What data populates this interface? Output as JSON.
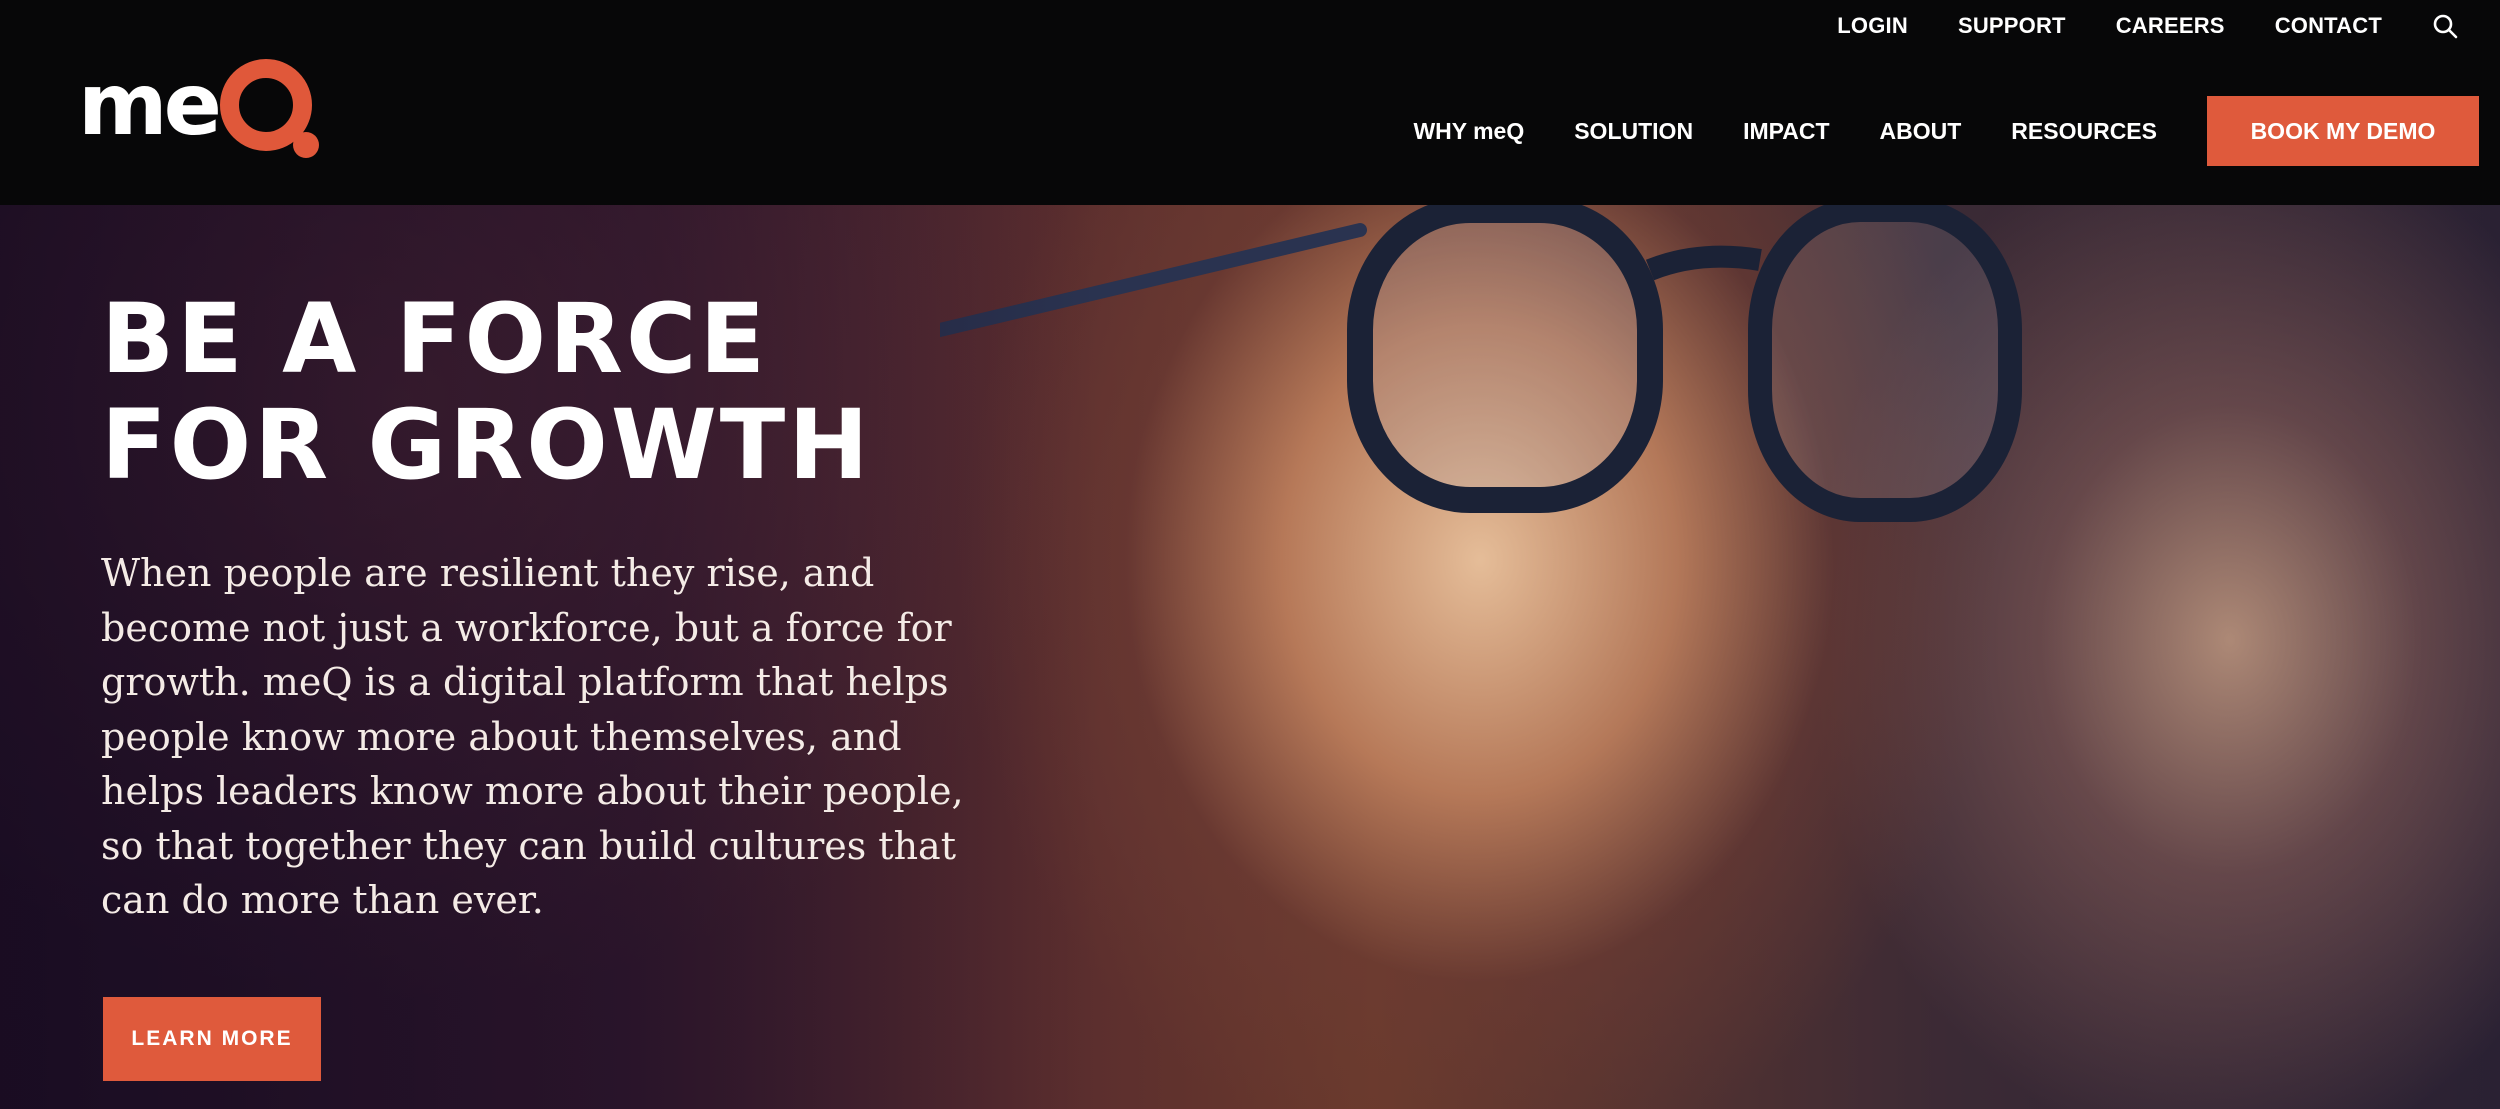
{
  "brand": {
    "logo_text": "me",
    "logo_q": "Q",
    "accent_color": "#df5a3c"
  },
  "utility_nav": {
    "items": [
      {
        "label": "LOGIN"
      },
      {
        "label": "SUPPORT"
      },
      {
        "label": "CAREERS"
      },
      {
        "label": "CONTACT"
      }
    ],
    "search_icon": "search-icon"
  },
  "main_nav": {
    "items": [
      {
        "label": "WHY meQ"
      },
      {
        "label": "SOLUTION"
      },
      {
        "label": "IMPACT"
      },
      {
        "label": "ABOUT"
      },
      {
        "label": "RESOURCES"
      }
    ],
    "cta_label": "BOOK MY DEMO"
  },
  "hero": {
    "title_line_1": "BE A FORCE",
    "title_line_2": "FOR GROWTH",
    "body": "When people are resilient they rise, and become not just a workforce, but a force for growth. meQ is a digital platform that helps people know more about themselves, and helps leaders know more about their people, so that together they can build cultures that can do more than ever.",
    "button_label": "LEARN MORE"
  }
}
